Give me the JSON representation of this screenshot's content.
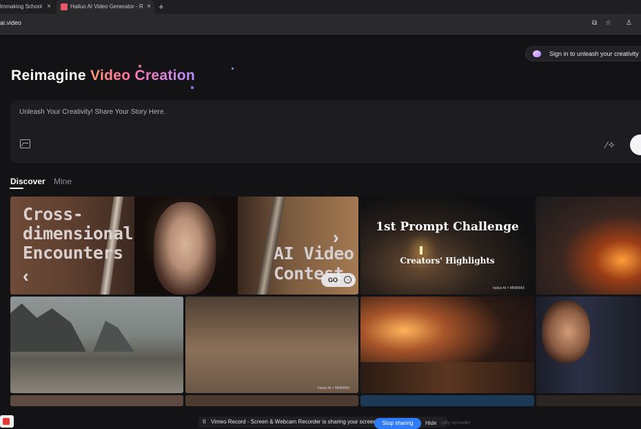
{
  "browser": {
    "tabs": [
      {
        "label": "lmmaking School"
      },
      {
        "label": "Hailuo AI Video Generator - R"
      }
    ],
    "new_tab": "+",
    "close_glyph": "×",
    "url": "ai.video"
  },
  "header": {
    "signin_label": "Sign in to unleash your creativity"
  },
  "hero": {
    "word1": "Reimagine",
    "word2": "Video",
    "word3": "Creation"
  },
  "prompt": {
    "placeholder": "Unleash Your Creativity! Share Your Story Here."
  },
  "feed_tabs": [
    {
      "label": "Discover",
      "active": true
    },
    {
      "label": "Mine",
      "active": false
    }
  ],
  "cards": {
    "banner": {
      "title_left": "Cross-\ndimensional\nEncounters",
      "title_right": "AI Video\nContest",
      "go_label": "GO",
      "prev_glyph": "‹",
      "next_glyph": "›"
    },
    "challenge": {
      "title": "1st Prompt Challenge",
      "subtitle": "Creators' Highlights",
      "watermark": "hailuo AI × MINIMAX"
    },
    "sand_watermark": "hailuo AI × MINIMAX"
  },
  "recorder": {
    "pause_glyph": "II",
    "message": "Vimeo Record - Screen & Webcam Recorder is sharing your screen.",
    "stop_label": "Stop sharing",
    "hide_label": "Hide",
    "faint_text": "ndly reminder"
  },
  "colors": {
    "page_bg": "#131315",
    "accent_send": "#f4f4f6",
    "stop_button": "#2f7cf6"
  }
}
